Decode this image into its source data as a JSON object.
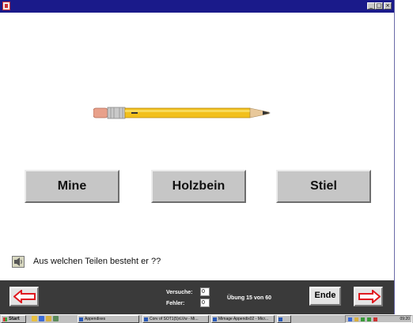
{
  "window": {
    "controls": {
      "minimize": "_",
      "maximize": "□",
      "close": "×"
    }
  },
  "exercise": {
    "image_icon": "pencil-illustration",
    "answers": [
      "Mine",
      "Holzbein",
      "Stiel"
    ],
    "question": "Aus welchen Teilen besteht er ??"
  },
  "controls": {
    "attempts_label": "Versuche:",
    "attempts_value": "0",
    "errors_label": "Fehler:",
    "errors_value": "0",
    "progress": "Übung 15 von 60",
    "end_label": "Ende",
    "prev_icon": "arrow-left-icon",
    "next_icon": "arrow-right-icon",
    "arrow_color": "#e0191f"
  },
  "taskbar": {
    "start_label": "Start",
    "tasks": [
      {
        "label": "Appendixes"
      },
      {
        "label": "Corv of SOT1(5)rLVw - Mi..."
      },
      {
        "label": "Mimage Appendix02 - Micr..."
      },
      {
        "label": ""
      }
    ],
    "clock": "09:20"
  }
}
